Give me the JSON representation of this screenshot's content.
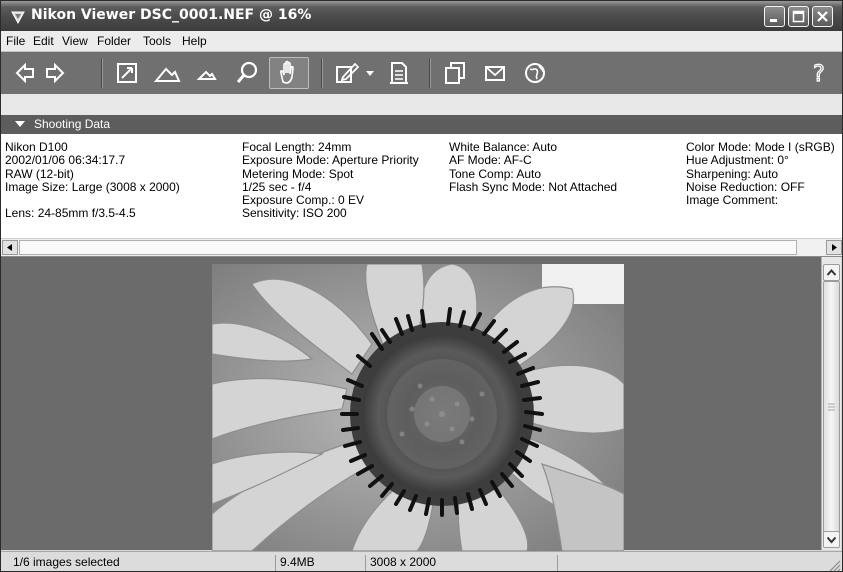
{
  "window": {
    "title": "Nikon Viewer DSC_0001.NEF @ 16%"
  },
  "menu": [
    "File",
    "Edit",
    "View",
    "Folder",
    "Tools",
    "Help"
  ],
  "toolbar": {
    "icons": [
      "back-icon",
      "forward-icon",
      "fit-screen-icon",
      "zoom-in-icon",
      "zoom-out-icon",
      "magnifier-icon",
      "hand-icon",
      "edit-icon",
      "dropdown-icon",
      "properties-icon",
      "copy-icon",
      "email-icon",
      "web-icon",
      "help-icon"
    ],
    "help_label": "?"
  },
  "shooting_data": {
    "header": "Shooting Data",
    "col1": [
      "Nikon D100",
      "2002/01/06 06:34:17.7",
      "RAW (12-bit)",
      "Image Size:  Large (3008 x 2000)",
      "",
      "Lens: 24-85mm f/3.5-4.5"
    ],
    "col2": [
      "Focal Length: 24mm",
      "Exposure Mode: Aperture Priority",
      "Metering Mode: Spot",
      "1/25 sec - f/4",
      "Exposure Comp.: 0 EV",
      "Sensitivity: ISO 200"
    ],
    "col3": [
      "White Balance: Auto",
      "AF Mode: AF-C",
      "Tone Comp: Auto",
      "Flash Sync Mode: Not Attached"
    ],
    "col4": [
      "Color Mode: Mode I (sRGB)",
      "Hue Adjustment: 0°",
      "Sharpening: Auto",
      "Noise Reduction: OFF",
      "Image Comment:"
    ]
  },
  "status": {
    "selection": "1/6 images selected",
    "size": "9.4MB",
    "dimensions": "3008 x 2000"
  },
  "colors": {
    "titlebar": "#4a4a4a",
    "toolbar": "#707070",
    "viewer_bg": "#6b6b6b"
  }
}
